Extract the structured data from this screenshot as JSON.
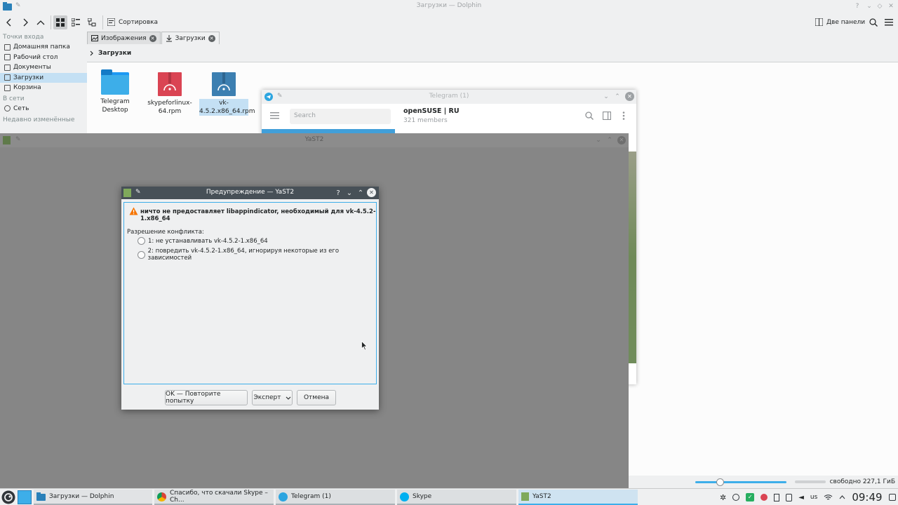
{
  "dolphin": {
    "window_title": "Загрузки — Dolphin",
    "toolbar": {
      "sort_label": "Сортировка",
      "split_label": "Две панели"
    },
    "places": {
      "section_entry": "Точки входа",
      "items": [
        "Домашняя папка",
        "Рабочий стол",
        "Документы",
        "Загрузки",
        "Корзина"
      ],
      "section_network": "В сети",
      "network_items": [
        "Сеть"
      ],
      "section_recent": "Недавно изменённые"
    },
    "tabs": [
      {
        "label": "Изображения"
      },
      {
        "label": "Загрузки"
      }
    ],
    "breadcrumb": "Загрузки",
    "files": [
      {
        "name": "Telegram Desktop",
        "icon": "folder-icon"
      },
      {
        "name": "skypeforlinux-64.rpm",
        "icon": "rpm-package-icon"
      },
      {
        "name": "vk-4.5.2.x86_64.rpm",
        "icon": "rpm-package-icon"
      }
    ],
    "status": {
      "free_space": "свободно 227,1 ГиБ"
    }
  },
  "telegram": {
    "window_title": "Telegram (1)",
    "search_placeholder": "Search",
    "chat_title": "openSUSE | RU",
    "chat_members": "321 members"
  },
  "yast": {
    "window_title": "YaST2"
  },
  "dialog": {
    "window_title": "Предупреждение — YaST2",
    "message": "ничто не предоставляет libappindicator, необходимый для vk-4.5.2-1.x86_64",
    "resolution_label": "Разрешение конфликта:",
    "options": [
      "1: не устанавливать vk-4.5.2-1.x86_64",
      "2: повредить vk-4.5.2-1.x86_64, игнорируя некоторые из его зависимостей"
    ],
    "buttons": {
      "ok": "OK — Повторите попытку",
      "expert": "Эксперт",
      "cancel": "Отмена"
    }
  },
  "taskbar": {
    "tasks": [
      "Загрузки — Dolphin",
      "Спасибо, что скачали Skype – Ch...",
      "Telegram (1)",
      "Skype",
      "YaST2"
    ],
    "keyboard_layout": "us",
    "clock": "09:49"
  },
  "colors": {
    "accent": "#3daee9",
    "selection": "#c4e0f4",
    "dialog_titlebar": "#475057",
    "overlay": "#868686",
    "warning": "#f67400"
  }
}
